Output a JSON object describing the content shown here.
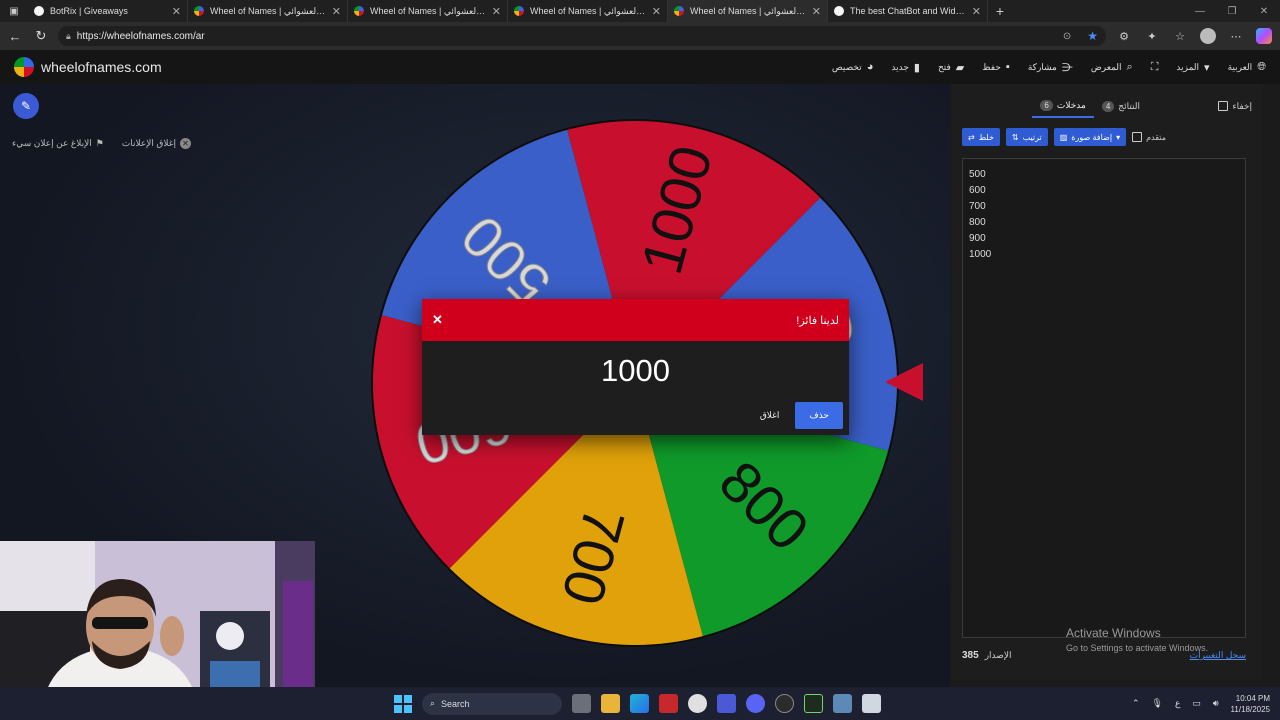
{
  "browser": {
    "tabs": [
      {
        "title": "BotRix | Giveaways",
        "active": false
      },
      {
        "title": "Wheel of Names | الاسم العشوائي",
        "active": false
      },
      {
        "title": "Wheel of Names | الاسم العشوائي",
        "active": false
      },
      {
        "title": "Wheel of Names | الاسم العشوائي",
        "active": false
      },
      {
        "title": "Wheel of Names | الاسم العشوائي",
        "active": true
      },
      {
        "title": "The best ChatBot and Widgets fo",
        "active": false
      }
    ],
    "new_tab": "+",
    "url": "https://wheelofnames.com/ar"
  },
  "app": {
    "logo_text": "wheelofnames.com",
    "menu": [
      {
        "label": "تخصيص",
        "icon": "palette-icon"
      },
      {
        "label": "جديد",
        "icon": "file-icon"
      },
      {
        "label": "فتح",
        "icon": "folder-icon"
      },
      {
        "label": "حفظ",
        "icon": "save-icon"
      },
      {
        "label": "مشاركة",
        "icon": "share-icon"
      },
      {
        "label": "المعرض",
        "icon": "search-icon"
      },
      {
        "label": "",
        "icon": "fullscreen-icon"
      },
      {
        "label": "المزيد",
        "icon": "chevron-down-icon"
      },
      {
        "label": "العربية",
        "icon": "globe-icon"
      }
    ]
  },
  "ads": {
    "report_label": "الإبلاغ عن إعلان سيء",
    "close_label": "إغلاق الإعلانات"
  },
  "wheel": {
    "colors": {
      "red": "#c8102e",
      "blue": "#3a5fc8",
      "yellow": "#e0a10a",
      "green": "#0f9a2a"
    }
  },
  "panel": {
    "hide_label": "إخفاء",
    "tab_entries": {
      "label": "مدخلات",
      "count": "6"
    },
    "tab_results": {
      "label": "النتائج",
      "count": "4"
    },
    "shuffle_label": "خلط",
    "sort_label": "ترتيب",
    "add_image_label": "إضافة صورة",
    "advanced_label": "متقدم",
    "entries": [
      "500",
      "600",
      "700",
      "800",
      "900",
      "1000"
    ],
    "version_label": "الإصدار",
    "version_number": "385",
    "changelog_label": "سجل التغييرات"
  },
  "watermark": {
    "line1": "Activate Windows",
    "line2": "Go to Settings to activate Windows."
  },
  "modal": {
    "title": "لدينا فائز!",
    "winner": "1000",
    "remove_label": "حذف",
    "close_label": "اغلاق"
  },
  "taskbar": {
    "search_placeholder": "Search",
    "lang": "ع",
    "time": "10:04 PM",
    "date": "11/18/2025"
  }
}
